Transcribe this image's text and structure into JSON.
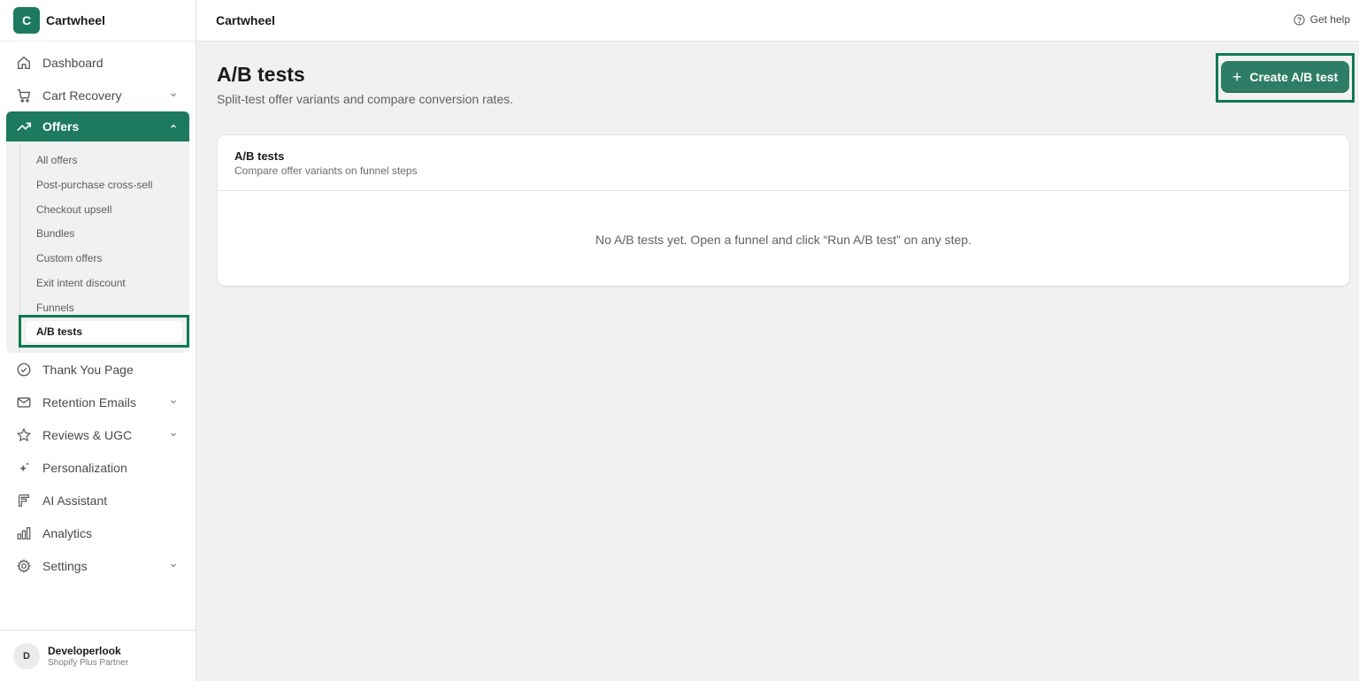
{
  "app": {
    "name": "Cartwheel",
    "logo_letter": "C"
  },
  "topbar": {
    "title": "Cartwheel",
    "help_label": "Get help"
  },
  "nav": {
    "dashboard": "Dashboard",
    "cart_recovery": "Cart Recovery",
    "offers": "Offers",
    "offers_sub": [
      "All offers",
      "Post-purchase cross-sell",
      "Checkout upsell",
      "Bundles",
      "Custom offers",
      "Exit intent discount",
      "Funnels",
      "A/B tests"
    ],
    "thank_you": "Thank You Page",
    "retention_emails": "Retention Emails",
    "reviews": "Reviews & UGC",
    "personalization": "Personalization",
    "ai_assistant": "AI Assistant",
    "analytics": "Analytics",
    "settings": "Settings"
  },
  "user": {
    "initial": "D",
    "name": "Developerlook",
    "role": "Shopify Plus Partner"
  },
  "page": {
    "title": "A/B tests",
    "subtitle": "Split-test offer variants and compare conversion rates.",
    "create_button": "Create A/B test"
  },
  "card": {
    "title": "A/B tests",
    "subtitle": "Compare offer variants on funnel steps",
    "empty_text": "No A/B tests yet. Open a funnel and click “Run A/B test” on any step."
  },
  "colors": {
    "accent": "#1e7a5f",
    "button": "#2e7d66",
    "highlight": "#0e7a4f"
  },
  "icons": [
    "home-icon",
    "cart-icon",
    "trending-up-icon",
    "check-circle-icon",
    "mail-icon",
    "star-icon",
    "sparkle-icon",
    "ai-icon",
    "bar-chart-icon",
    "gear-icon",
    "help-icon",
    "plus-icon",
    "chevron-down-icon",
    "chevron-up-icon"
  ]
}
